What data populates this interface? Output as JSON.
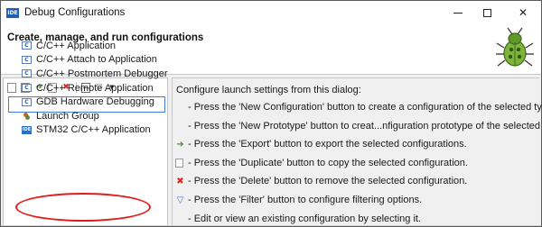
{
  "window": {
    "app_icon_text": "IDE",
    "title": "Debug Configurations",
    "minimize_glyph": "—",
    "close_glyph": "✕"
  },
  "header": {
    "title": "Create, manage, and run configurations",
    "icon": "bug-icon"
  },
  "left_panel": {
    "toolbar": [
      {
        "name": "new-configuration-icon"
      },
      {
        "name": "new-prototype-icon"
      },
      {
        "name": "export-icon"
      },
      {
        "name": "duplicate-icon"
      },
      {
        "name": "delete-icon"
      },
      {
        "name": "collapse-all-icon"
      },
      {
        "name": "filter-icon"
      },
      {
        "name": "view-menu-dropdown-icon"
      }
    ],
    "filter_value": "",
    "tree_items": [
      {
        "label": "C/C++ Application",
        "icon_text": "C"
      },
      {
        "label": "C/C++ Attach to Application",
        "icon_text": "C"
      },
      {
        "label": "C/C++ Postmortem Debugger",
        "icon_text": "C"
      },
      {
        "label": "C/C++ Remote Application",
        "icon_text": "C"
      },
      {
        "label": "GDB Hardware Debugging",
        "icon_text": "C"
      },
      {
        "label": "Launch Group",
        "icon_text": ""
      },
      {
        "label": "STM32 C/C++ Application",
        "icon_text": "IDE"
      }
    ],
    "highlight_color": "#e21b1b"
  },
  "right_panel": {
    "intro": "Configure launch settings from this dialog:",
    "lines": [
      {
        "icon": "",
        "text": "- Press the 'New Configuration' button to create a configuration of the selected type."
      },
      {
        "icon": "",
        "text": "- Press the 'New Prototype' button to creat...nfiguration prototype of the selected type."
      },
      {
        "icon": "export-icon",
        "text": "- Press the 'Export' button to export the selected configurations."
      },
      {
        "icon": "duplicate-icon",
        "text": "- Press the 'Duplicate' button to copy the selected configuration."
      },
      {
        "icon": "delete-icon",
        "text": "- Press the 'Delete' button to remove the selected configuration."
      },
      {
        "icon": "filter-icon",
        "text": "- Press the 'Filter' button to configure filtering options."
      },
      {
        "icon": "",
        "text": "- Edit or view an existing configuration by selecting it."
      }
    ]
  }
}
